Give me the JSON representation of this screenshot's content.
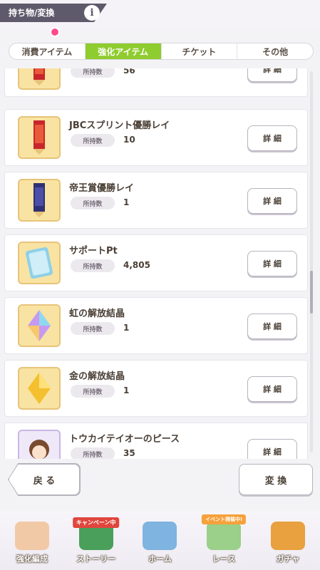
{
  "header": {
    "title": "持ち物/変換",
    "info_icon": "info-icon"
  },
  "tabs": [
    {
      "label": "消費アイテム",
      "active": false
    },
    {
      "label": "強化アイテム",
      "active": true
    },
    {
      "label": "チケット",
      "active": false
    },
    {
      "label": "その他",
      "active": false
    }
  ],
  "items": [
    {
      "name": "",
      "qty_label": "所持数",
      "qty": "56",
      "detail_label": "詳 細",
      "icon": "red-lei-icon",
      "color": "#c8262b"
    },
    {
      "name": "JBCスプリント優勝レイ",
      "qty_label": "所持数",
      "qty": "10",
      "detail_label": "詳 細",
      "icon": "red-lei-icon",
      "color": "#c8262b"
    },
    {
      "name": "帝王賞優勝レイ",
      "qty_label": "所持数",
      "qty": "1",
      "detail_label": "詳 細",
      "icon": "navy-lei-icon",
      "color": "#2f3173"
    },
    {
      "name": "サポートPt",
      "qty_label": "所持数",
      "qty": "4,805",
      "detail_label": "詳 細",
      "icon": "support-card-icon",
      "color": "#8fd0e8"
    },
    {
      "name": "虹の解放結晶",
      "qty_label": "所持数",
      "qty": "1",
      "detail_label": "詳 細",
      "icon": "rainbow-crystal-icon",
      "color": "#c59af0"
    },
    {
      "name": "金の解放結晶",
      "qty_label": "所持数",
      "qty": "1",
      "detail_label": "詳 細",
      "icon": "gold-crystal-icon",
      "color": "#f4c030"
    },
    {
      "name": "トウカイテイオーのピース",
      "qty_label": "所持数",
      "qty": "35",
      "detail_label": "詳 細",
      "icon": "character-piece-icon",
      "color": "#c9b7e6"
    }
  ],
  "buttons": {
    "back": "戻 る",
    "convert": "変 換"
  },
  "nav": [
    {
      "label": "強化編成",
      "icon": "character-icon",
      "badge": ""
    },
    {
      "label": "ストーリー",
      "icon": "story-book-icon",
      "badge": "キャンペーン中"
    },
    {
      "label": "ホーム",
      "icon": "home-building-icon",
      "badge": ""
    },
    {
      "label": "レース",
      "icon": "race-icon",
      "badge": "イベント開催中!"
    },
    {
      "label": "ガチャ",
      "icon": "gacha-icon",
      "badge": ""
    }
  ]
}
